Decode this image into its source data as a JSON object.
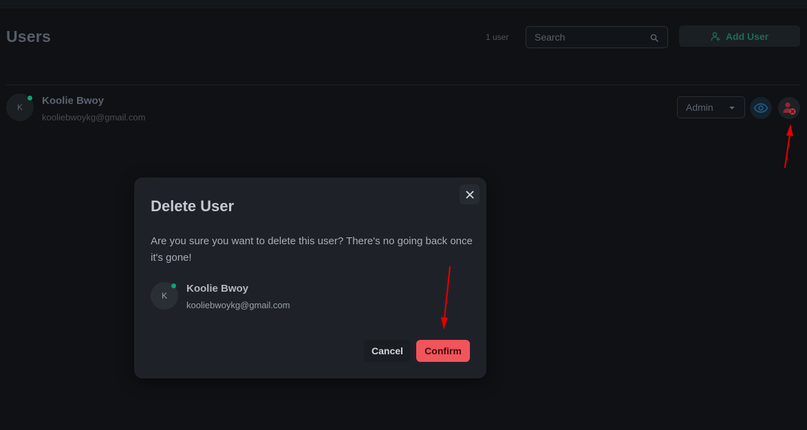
{
  "header": {
    "title": "Users",
    "user_count": "1 user",
    "search_placeholder": "Search",
    "add_user_label": "Add User"
  },
  "users": [
    {
      "initial": "K",
      "name": "Koolie Bwoy",
      "email": "kooliebwoykg@gmail.com",
      "role": "Admin",
      "online": true
    }
  ],
  "modal": {
    "title": "Delete User",
    "message": "Are you sure you want to delete this user? There's no going back once it's gone!",
    "user": {
      "initial": "K",
      "name": "Koolie Bwoy",
      "email": "kooliebwoykg@gmail.com"
    },
    "cancel_label": "Cancel",
    "confirm_label": "Confirm"
  },
  "icons": {
    "search": "search-icon",
    "add_user": "user-plus-icon",
    "view": "eye-icon",
    "delete_user": "user-remove-icon",
    "close": "close-icon",
    "role_caret": "caret-down-icon"
  },
  "colors": {
    "accent_green": "#1f6b55",
    "online": "#10a273",
    "danger": "#f2545b",
    "view_blue": "#1c5c86",
    "annotation_red": "#e00000"
  }
}
